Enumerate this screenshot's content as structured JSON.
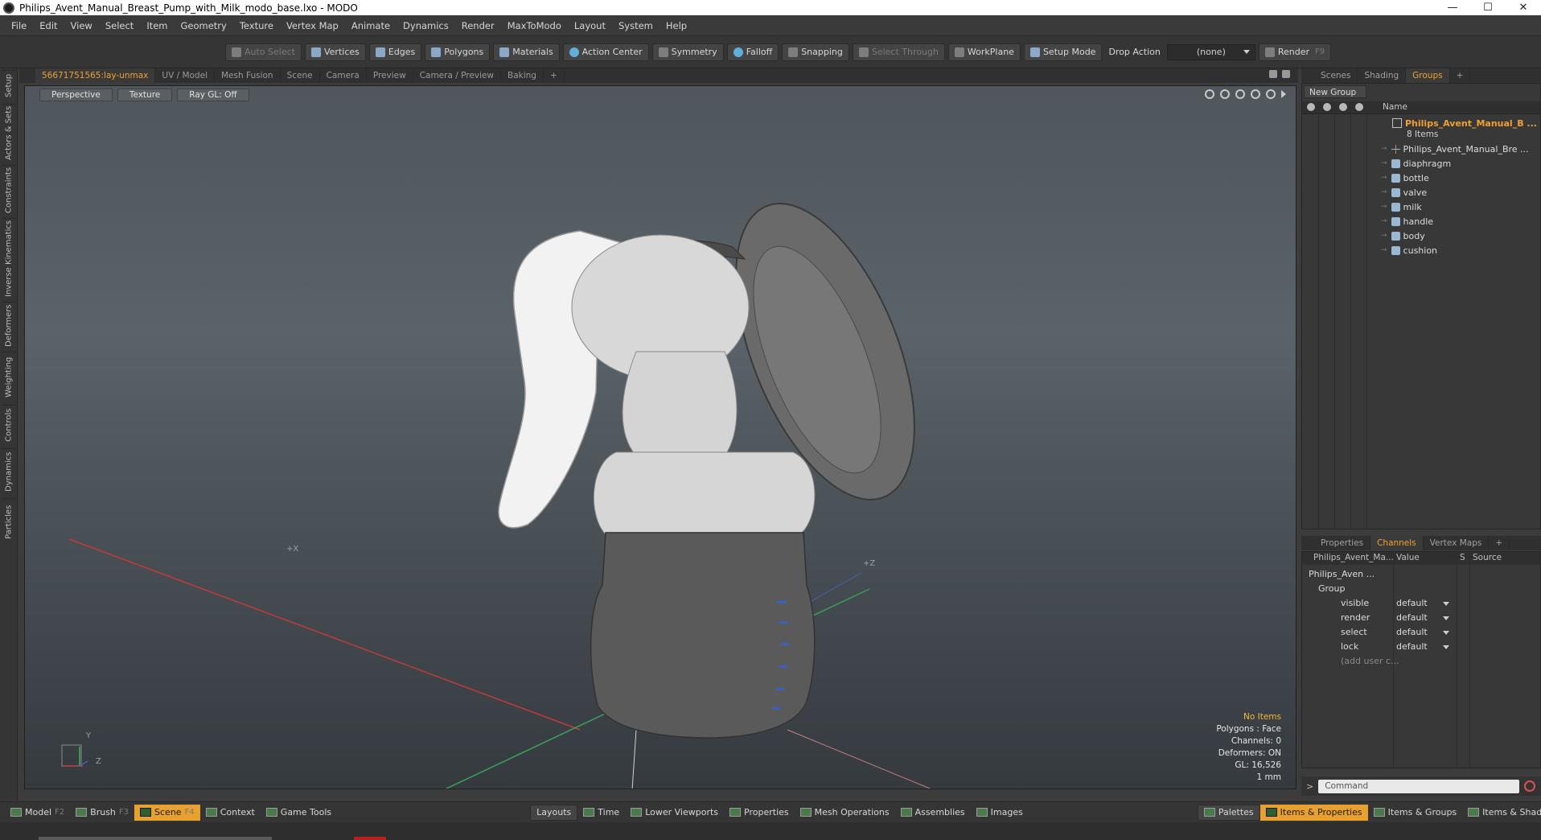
{
  "window": {
    "title": "Philips_Avent_Manual_Breast_Pump_with_Milk_modo_base.lxo - MODO",
    "controls": [
      "—",
      "☐",
      "✕"
    ]
  },
  "menu": [
    "File",
    "Edit",
    "View",
    "Select",
    "Item",
    "Geometry",
    "Texture",
    "Vertex Map",
    "Animate",
    "Dynamics",
    "Render",
    "MaxToModo",
    "Layout",
    "System",
    "Help"
  ],
  "toolbar": {
    "auto_select": "Auto Select",
    "vertices": "Vertices",
    "edges": "Edges",
    "polygons": "Polygons",
    "materials": "Materials",
    "action_center": "Action Center",
    "symmetry": "Symmetry",
    "falloff": "Falloff",
    "snapping": "Snapping",
    "select_through": "Select Through",
    "workplane": "WorkPlane",
    "setup_mode": "Setup Mode",
    "drop_action_label": "Drop Action",
    "drop_action_value": "(none)",
    "render": "Render",
    "render_key": "F9"
  },
  "left_tabs": [
    "Setup",
    "Actors & Sets",
    "Constraints",
    "Inverse Kinematics",
    "Deformers",
    "Weighting",
    "Controls",
    "Dynamics",
    "Particles"
  ],
  "viewport_tabs": [
    "56671751565:lay-unmax",
    "UV / Model",
    "Mesh Fusion",
    "Scene",
    "Camera",
    "Preview",
    "Camera / Preview",
    "Baking",
    "+"
  ],
  "viewport": {
    "view_mode": "Perspective",
    "shading": "Texture",
    "ray_gl": "Ray GL: Off",
    "axis_x": "+X",
    "axis_z": "+Z",
    "gizmo_y": "Y",
    "gizmo_z": "Z",
    "info": {
      "selection": "No Items",
      "polygons": "Polygons : Face",
      "channels": "Channels: 0",
      "deformers": "Deformers: ON",
      "gl": "GL: 16,526",
      "unit": "1 mm"
    }
  },
  "right_top_tabs": [
    "Scenes",
    "Shading",
    "Groups",
    "+"
  ],
  "groups": {
    "new_group": "New Group",
    "name_header": "Name",
    "group_name": "Philips_Avent_Manual_B ...",
    "item_count": "8 Items",
    "items": [
      {
        "name": "Philips_Avent_Manual_Bre ...",
        "icon": "locator-icon"
      },
      {
        "name": "diaphragm",
        "icon": "mesh-icon"
      },
      {
        "name": "bottle",
        "icon": "mesh-icon"
      },
      {
        "name": "valve",
        "icon": "mesh-icon"
      },
      {
        "name": "milk",
        "icon": "mesh-icon"
      },
      {
        "name": "handle",
        "icon": "mesh-icon"
      },
      {
        "name": "body",
        "icon": "mesh-icon"
      },
      {
        "name": "cushion",
        "icon": "mesh-icon"
      }
    ]
  },
  "right_mid_tabs": [
    "Properties",
    "Channels",
    "Vertex Maps",
    "+"
  ],
  "channels": {
    "header_item": "Philips_Avent_Ma...",
    "header_value": "Value",
    "header_s": "S",
    "header_source": "Source",
    "root": "Philips_Aven ...",
    "group": "Group",
    "rows": [
      {
        "name": "visible",
        "value": "default"
      },
      {
        "name": "render",
        "value": "default"
      },
      {
        "name": "select",
        "value": "default"
      },
      {
        "name": "lock",
        "value": "default"
      }
    ],
    "add_user": "(add user c..."
  },
  "command": {
    "placeholder": "Command",
    "prompt": ">"
  },
  "bottom": {
    "left": [
      {
        "label": "Model",
        "key": "F2"
      },
      {
        "label": "Brush",
        "key": "F3"
      },
      {
        "label": "Scene",
        "key": "F4"
      },
      {
        "label": "Context",
        "key": ""
      },
      {
        "label": "Game Tools",
        "key": ""
      }
    ],
    "center": [
      "Layouts",
      "Time",
      "Lower Viewports",
      "Properties",
      "Mesh Operations",
      "Assemblies",
      "Images"
    ],
    "right": [
      "Palettes",
      "Items & Properties",
      "Items & Groups",
      "Items & Shading"
    ]
  },
  "colors": {
    "accent": "#f0a030",
    "active_tab": "#e8a12e"
  }
}
